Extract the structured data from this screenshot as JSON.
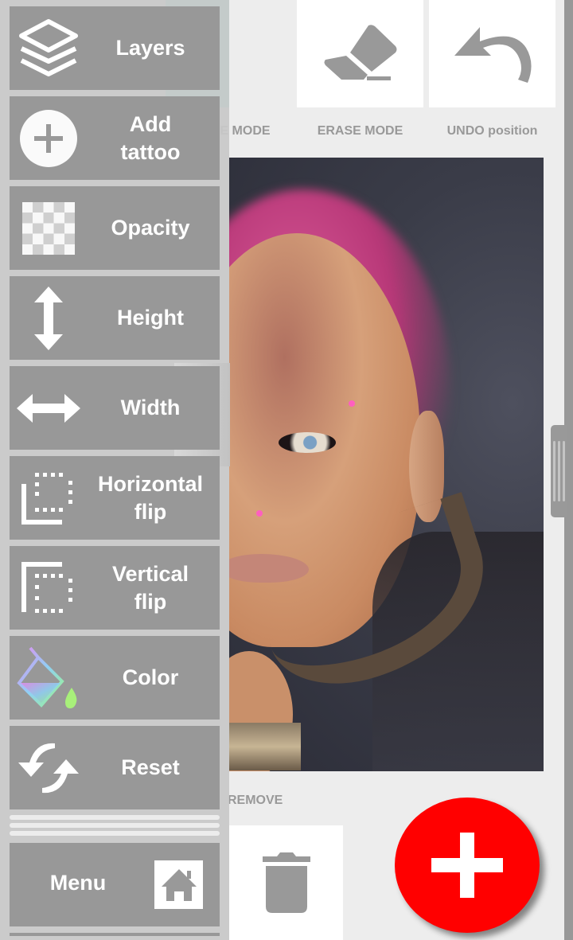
{
  "toolbar": {
    "buttons": [
      {
        "label": "MOVE MODE",
        "visible_label": "E MODE",
        "icon": "move-arrows-icon",
        "active": true
      },
      {
        "label": "ERASE MODE",
        "icon": "eraser-icon",
        "active": false
      },
      {
        "label": "UNDO position",
        "icon": "undo-icon",
        "active": false
      }
    ]
  },
  "canvas": {
    "image": "portrait of woman with pink undercut hair, piercings and leather collar"
  },
  "bottom": {
    "remove_label": "REMOVE",
    "remove_icon": "trash-icon",
    "add_icon": "plus-icon"
  },
  "drawer": {
    "items": [
      {
        "label": "Layers",
        "icon": "layers-icon"
      },
      {
        "label": "Add\ntattoo",
        "icon": "add-circle-icon"
      },
      {
        "label": "Opacity",
        "icon": "checkerboard-icon"
      },
      {
        "label": "Height",
        "icon": "vertical-arrow-icon"
      },
      {
        "label": "Width",
        "icon": "horizontal-arrow-icon"
      },
      {
        "label": "Horizontal\nflip",
        "icon": "horizontal-flip-icon"
      },
      {
        "label": "Vertical\nflip",
        "icon": "vertical-flip-icon"
      },
      {
        "label": "Color",
        "icon": "paint-bucket-icon"
      },
      {
        "label": "Reset",
        "icon": "refresh-icon"
      }
    ],
    "menu": {
      "label": "Menu",
      "icon": "home-icon"
    }
  },
  "colors": {
    "active_tool": "#92eed8",
    "fab": "#ff0000",
    "drawer_item": "#989898",
    "label_gray": "#999999"
  }
}
